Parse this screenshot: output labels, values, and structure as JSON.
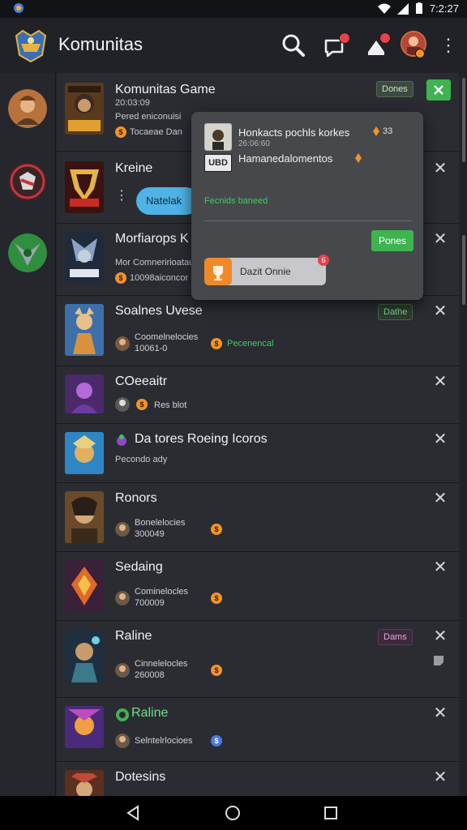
{
  "status_bar": {
    "time": "7:2:27"
  },
  "app": {
    "title": "Komunitas"
  },
  "top_icons": [
    "search-icon",
    "messages-icon",
    "notifications-icon"
  ],
  "rows": [
    {
      "title": "Komunitas Game",
      "subtitle": "20:03:09",
      "line2": "Pered eniconuisi",
      "line3": "Tocaeae Dan",
      "tag": "Dones"
    },
    {
      "title": "Kreine",
      "pill": "Natelak"
    },
    {
      "title": "Morfiarops K",
      "line2": "Mor Comneririoatau",
      "line3": "10098aiconcor"
    },
    {
      "title": "Soalnes Uvese",
      "meta1": "Coomelnelocies",
      "meta2": "10061-0",
      "status": "Pecenencal",
      "tag": "Dathe"
    },
    {
      "title": "COeeaitr",
      "meta1": "Res blot"
    },
    {
      "title": "Da tores Roeing Icoros",
      "subtitle": "Pecondo ady"
    },
    {
      "title": "Ronors",
      "meta1": "Bonelelocies",
      "meta2": "300049"
    },
    {
      "title": "Sedaing",
      "meta1": "Cominelocles",
      "meta2": "700009"
    },
    {
      "title": "Raline",
      "meta1": "Cinnelelocles",
      "meta2": "260008",
      "tag": "Dams"
    },
    {
      "title": "Raline",
      "meta1": "Selntelrlocioes"
    },
    {
      "title": "Dotesins"
    }
  ],
  "popup": {
    "line1": "Honkacts pochls korkes",
    "line1_count": "33",
    "line1_sub": "26:06:60",
    "badge_text": "UBD",
    "line2": "Hamanedalomentos",
    "status": "Fecnids baneed",
    "button": "Pones",
    "action": "Dazit Onnie",
    "action_badge": "6"
  },
  "colors": {
    "accent_green": "#3fb350",
    "orange": "#f0932b",
    "danger": "#e0454e"
  }
}
